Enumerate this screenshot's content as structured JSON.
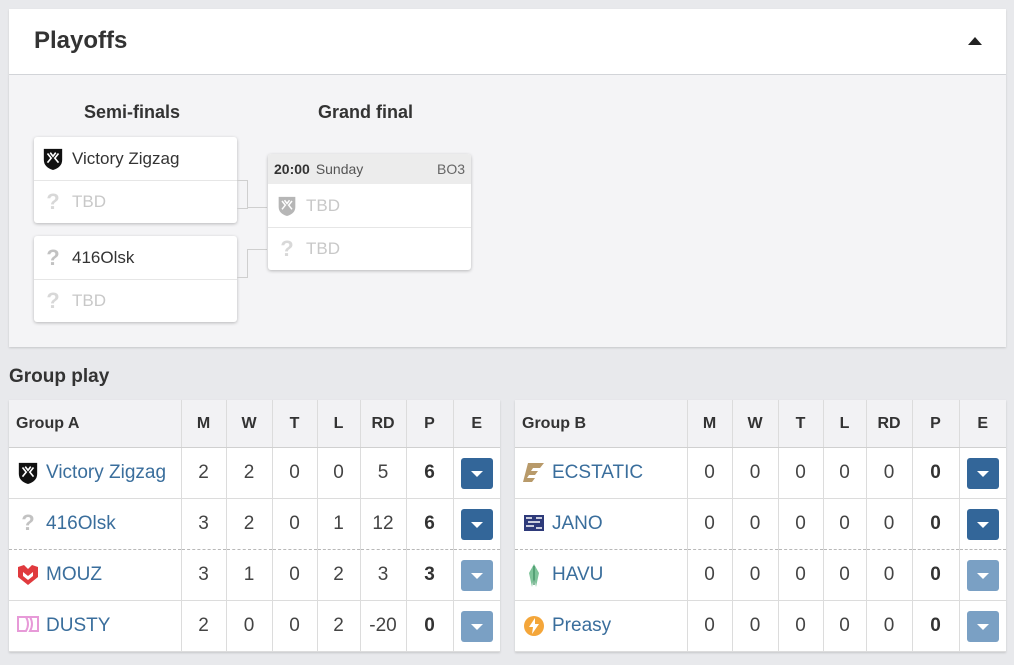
{
  "playoffs": {
    "title": "Playoffs",
    "rounds": {
      "semis": "Semi-finals",
      "final": "Grand final"
    },
    "semis": [
      {
        "top": "Victory Zigzag",
        "bottom": "TBD"
      },
      {
        "top": "416Olsk",
        "bottom": "TBD"
      }
    ],
    "final": {
      "time": "20:00",
      "day": "Sunday",
      "format": "BO3",
      "top": "TBD",
      "bottom": "TBD"
    }
  },
  "group_play": {
    "title": "Group play",
    "columns": [
      "M",
      "W",
      "T",
      "L",
      "RD",
      "P",
      "E"
    ],
    "groups": [
      {
        "name": "Group A",
        "rows": [
          {
            "team": "Victory Zigzag",
            "logo": "victory-zigzag-logo",
            "m": "2",
            "w": "2",
            "t": "0",
            "l": "0",
            "rd": "5",
            "p": "6"
          },
          {
            "team": "416Olsk",
            "logo": "question-mark-logo",
            "m": "3",
            "w": "2",
            "t": "0",
            "l": "1",
            "rd": "12",
            "p": "6"
          },
          {
            "team": "MOUZ",
            "logo": "mouz-logo",
            "m": "3",
            "w": "1",
            "t": "0",
            "l": "2",
            "rd": "3",
            "p": "3"
          },
          {
            "team": "DUSTY",
            "logo": "dusty-logo",
            "m": "2",
            "w": "0",
            "t": "0",
            "l": "2",
            "rd": "-20",
            "p": "0"
          }
        ]
      },
      {
        "name": "Group B",
        "rows": [
          {
            "team": "ECSTATIC",
            "logo": "ecstatic-logo",
            "m": "0",
            "w": "0",
            "t": "0",
            "l": "0",
            "rd": "0",
            "p": "0"
          },
          {
            "team": "JANO",
            "logo": "jano-logo",
            "m": "0",
            "w": "0",
            "t": "0",
            "l": "0",
            "rd": "0",
            "p": "0"
          },
          {
            "team": "HAVU",
            "logo": "havu-logo",
            "m": "0",
            "w": "0",
            "t": "0",
            "l": "0",
            "rd": "0",
            "p": "0"
          },
          {
            "team": "Preasy",
            "logo": "preasy-logo",
            "m": "0",
            "w": "0",
            "t": "0",
            "l": "0",
            "rd": "0",
            "p": "0"
          }
        ]
      }
    ]
  },
  "colors": {
    "link": "#3a6e9c",
    "expand_button": "#336699",
    "expand_button_light": "#7aa0c4"
  }
}
